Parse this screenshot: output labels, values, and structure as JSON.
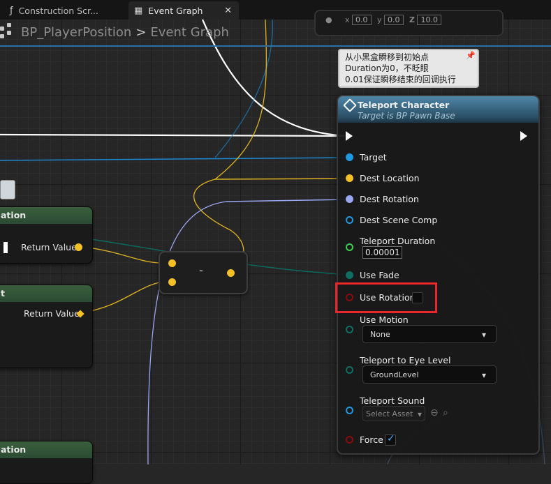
{
  "tabs": [
    {
      "icon": "function-icon",
      "label": "Construction Scr..."
    },
    {
      "icon": "event-graph-icon",
      "label": "Event Graph",
      "active": true
    }
  ],
  "breadcrumb": {
    "blueprint": "BP_PlayerPosition",
    "separator": ">",
    "graph": "Event Graph"
  },
  "comment": {
    "lines": [
      "从小黑盒瞬移到初始点",
      "Duration为0，不眨眼",
      "0.01保证瞬移结束的回调执行"
    ]
  },
  "top_node": {
    "x_value": "0.0",
    "y_value": "0.0",
    "z_label": "Z",
    "z_value": "10.0"
  },
  "left_nodes": {
    "node1_title": "ation",
    "node1_return": "Return Value",
    "node2_title": "t",
    "node2_return": "Return Value",
    "node3_title": "ation"
  },
  "minus_node": {
    "operator": "-"
  },
  "teleport": {
    "title": "Teleport Character",
    "subtitle": "Target is BP Pawn Base",
    "pins": {
      "target": "Target",
      "dest_location": "Dest Location",
      "dest_rotation": "Dest Rotation",
      "dest_scene_comp": "Dest Scene Comp",
      "teleport_duration": "Teleport Duration",
      "teleport_duration_value": "0.00001",
      "use_fade": "Use Fade",
      "use_rotation": "Use Rotation",
      "use_motion": "Use Motion",
      "use_motion_value": "None",
      "teleport_eye_level": "Teleport to Eye Level",
      "teleport_eye_level_value": "GroundLevel",
      "teleport_sound": "Teleport Sound",
      "teleport_sound_value": "Select Asset",
      "force": "Force"
    },
    "use_rotation_checked": false,
    "force_checked": true
  },
  "colors": {
    "object_pin": "#1f9ae0",
    "vector_pin": "#f3c026",
    "rotator_pin": "#9aa8f3",
    "bool_pin": "#8b0b0b",
    "float_pin": "#3bd14e",
    "byte_pin": "#0f6e64",
    "highlight": "#e8262b"
  }
}
